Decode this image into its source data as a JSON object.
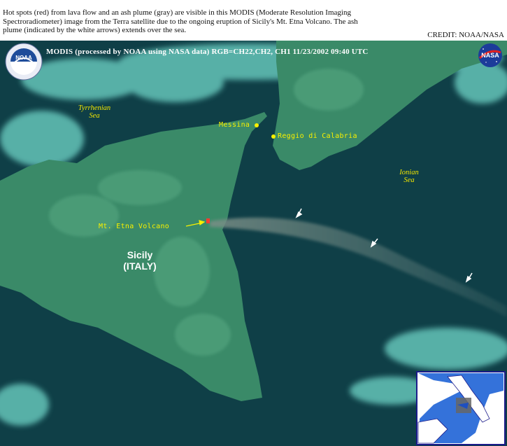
{
  "caption": "Hot spots (red) from lava flow and an ash plume (gray) are visible in this MODIS (Moderate Resolution Imaging Spectroradiometer) image from the Terra satellite due to the ongoing eruption of Sicily's Mt. Etna Volcano.  The ash plume (indicated by the white arrows) extends over the sea.",
  "credit": "CREDIT: NOAA/NASA",
  "image_header": "MODIS  (processed by NOAA using NASA data)  RGB=CH22,CH2, CH1  11/23/2002  09:40 UTC",
  "labels": {
    "messina": "Messina",
    "reggio": "Reggio di Calabria",
    "etna": "Mt. Etna Volcano",
    "tyrrhenian_1": "Tyrrhenian",
    "tyrrhenian_2": "Sea",
    "ionian_1": "Ionian",
    "ionian_2": "Sea",
    "sicily": "Sicily",
    "italy": "(ITALY)"
  },
  "logos": {
    "noaa": "NOAA",
    "nasa": "NASA"
  },
  "colors": {
    "sea": "#0f3f47",
    "land": "#3a8a68",
    "cloud": "#6fd6c8",
    "label": "#f7f000",
    "hotspot": "#ff3b30"
  },
  "icons": [
    "noaa-logo-icon",
    "nasa-logo-icon",
    "plume-arrow-icon",
    "city-dot-icon",
    "hotspot-icon",
    "locator-inset-map"
  ]
}
